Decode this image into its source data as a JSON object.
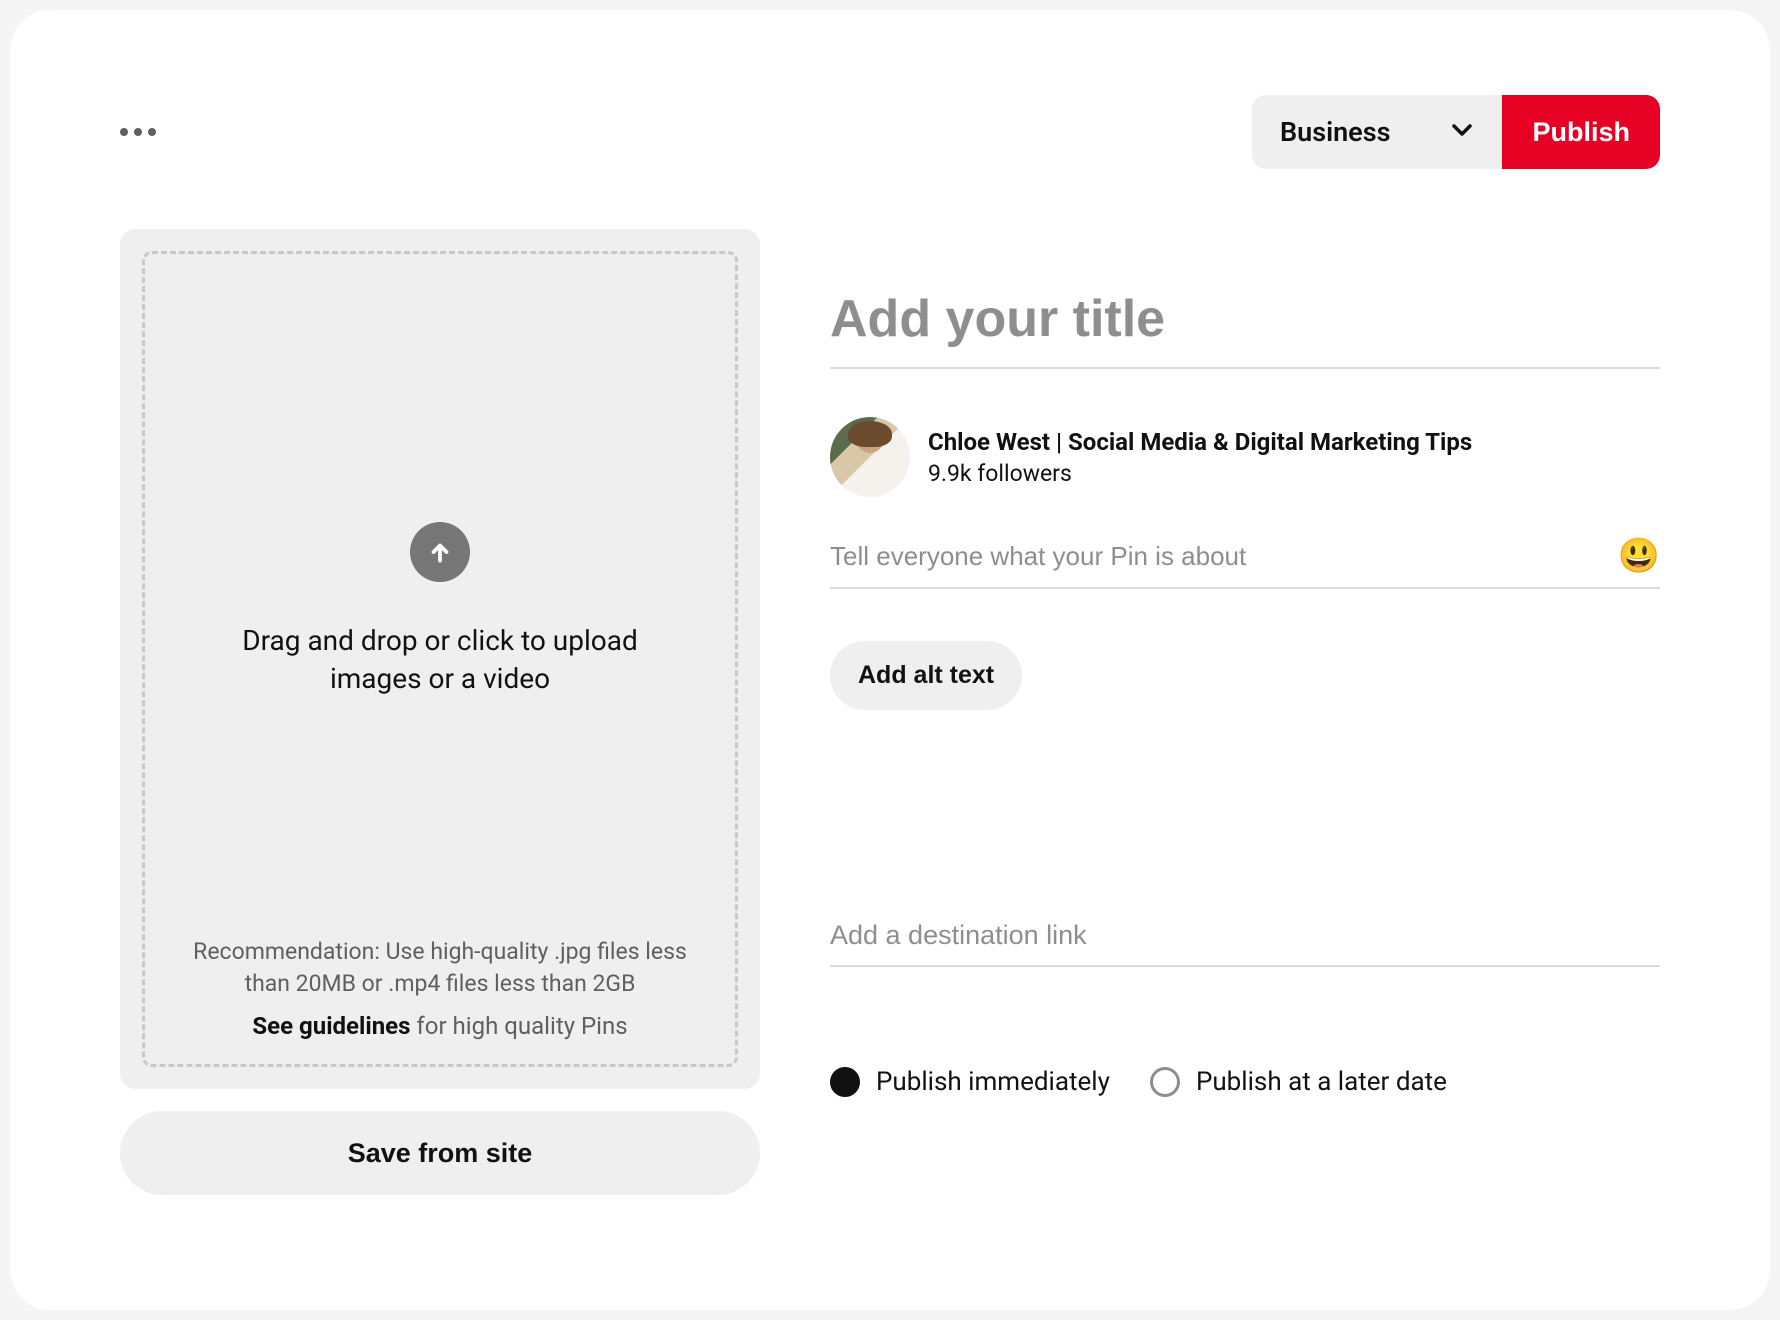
{
  "header": {
    "board_selected": "Business",
    "publish_label": "Publish"
  },
  "upload": {
    "main_text": "Drag and drop or click to upload images or a video",
    "recommendation": "Recommendation: Use high-quality .jpg files less than 20MB or .mp4 files less than 2GB",
    "guidelines_bold": "See guidelines",
    "guidelines_rest": " for high quality Pins",
    "save_from_site": "Save from site"
  },
  "form": {
    "title_placeholder": "Add your title",
    "profile_name": "Chloe West | Social Media & Digital Marketing Tips",
    "followers": "9.9k followers",
    "description_placeholder": "Tell everyone what your Pin is about",
    "emoji": "😃",
    "alt_text_label": "Add alt text",
    "link_placeholder": "Add a destination link"
  },
  "schedule": {
    "option_immediate": "Publish immediately",
    "option_later": "Publish at a later date",
    "selected": "immediate"
  }
}
